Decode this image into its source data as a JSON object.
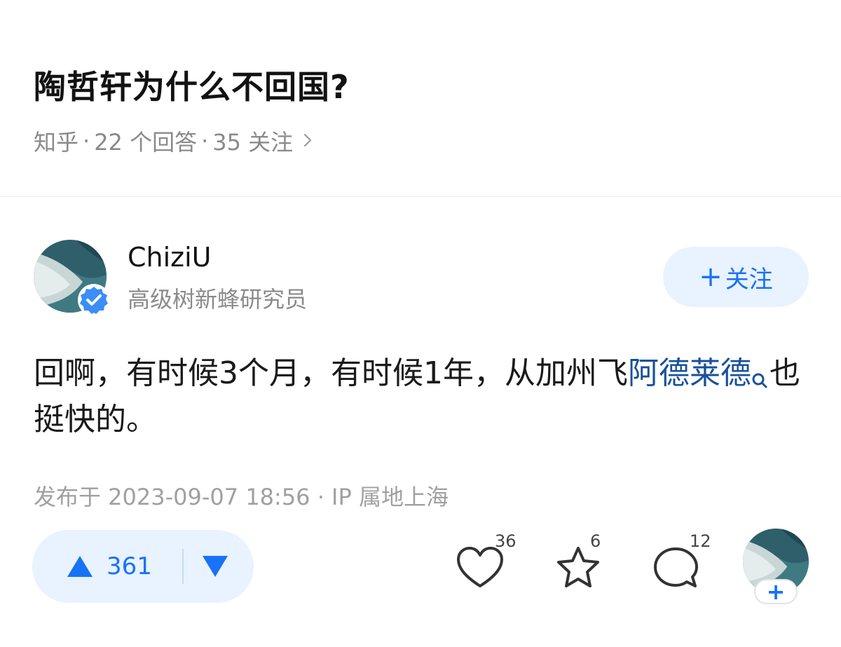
{
  "question": {
    "title": "陶哲轩为什么不回国?",
    "source": "知乎",
    "answers": "22 个回答",
    "followers": "35 关注",
    "sep": "·",
    "chevron_icon": "chevron-right-icon"
  },
  "author": {
    "name": "ChiziU",
    "bio": "高级树新蜂研究员",
    "verified_icon": "verified-badge-icon",
    "follow_plus": "+",
    "follow_label": "关注"
  },
  "answer": {
    "text_before": "回啊，有时候3个月，有时候1年，从加州飞",
    "link_text": "阿德莱德",
    "link_icon": "search-icon",
    "text_after": "也挺快的。",
    "publish_info": "发布于 2023-09-07 18:56 · IP 属地上海"
  },
  "actions": {
    "upvote_count": "361",
    "like_count": "36",
    "favorite_count": "6",
    "comment_count": "12",
    "footer_follow_plus": "+"
  },
  "colors": {
    "accent": "#1772f6",
    "accent_bg": "#e9f2ff",
    "link": "#175199",
    "meta": "#8a8a8a"
  }
}
